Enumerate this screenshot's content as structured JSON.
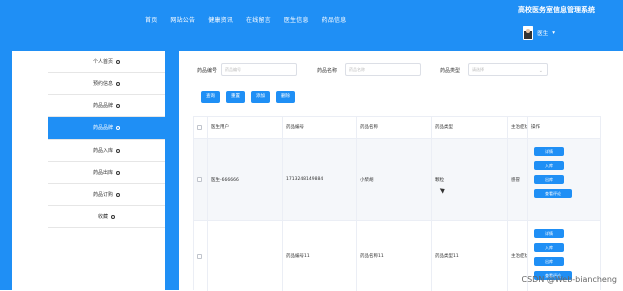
{
  "header": {
    "nav": [
      "首页",
      "网站公告",
      "健康资讯",
      "在线留言",
      "医生信息",
      "药品信息"
    ],
    "brand": "高校医务室信息管理系统",
    "user_name": "医生"
  },
  "sidebar": {
    "items": [
      "个人首页",
      "预约信息",
      "药品品牌",
      "药品品牌",
      "药品入库",
      "药品出库",
      "药品订购",
      "收藏"
    ],
    "active_index": 3
  },
  "search": {
    "fields": [
      {
        "label": "药品编号",
        "placeholder": "药品编号"
      },
      {
        "label": "药品名称",
        "placeholder": "药品名称"
      },
      {
        "label": "药品类型",
        "placeholder": "请选择"
      }
    ]
  },
  "buttons": [
    "查询",
    "重置",
    "添加",
    "删除"
  ],
  "table": {
    "headers": [
      "",
      "医生用户",
      "药品编号",
      "药品名称",
      "药品类型",
      "主治症状",
      "操作"
    ],
    "rows": [
      {
        "cells": [
          "",
          "医生-666666",
          "1713248149884",
          "小柴胡",
          "颗粒",
          "感冒"
        ],
        "actions": [
          "详情",
          "入库",
          "出库",
          "查看评论"
        ]
      },
      {
        "cells": [
          "",
          "",
          "药品编号11",
          "药品名称11",
          "药品类型11",
          "主治症状11"
        ],
        "actions": [
          "详情",
          "入库",
          "出库",
          "查看评论"
        ]
      }
    ]
  },
  "watermark": "CSDN @Web-biancheng"
}
